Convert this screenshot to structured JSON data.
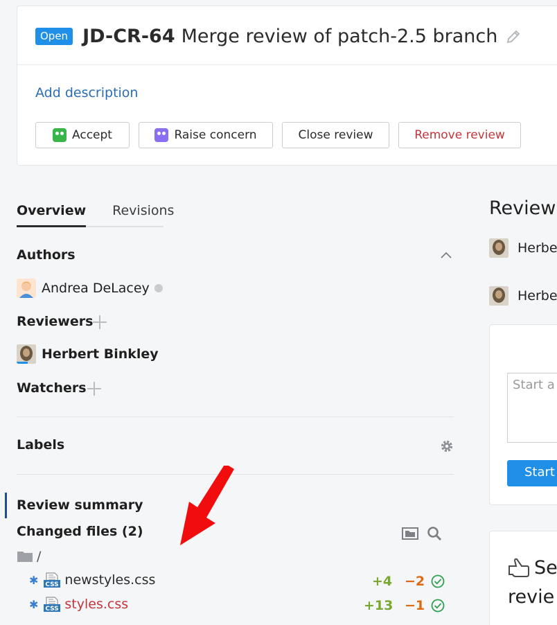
{
  "header": {
    "status": "Open",
    "review_id": "JD-CR-64",
    "title": "Merge review of patch-2.5 branch",
    "add_description": "Add description",
    "buttons": {
      "accept": "Accept",
      "raise_concern": "Raise concern",
      "close_review": "Close review",
      "remove_review": "Remove review"
    }
  },
  "tabs": [
    "Overview",
    "Revisions"
  ],
  "sidebar": {
    "authors_title": "Authors",
    "author_name": "Andrea DeLacey",
    "reviewers_title": "Reviewers",
    "reviewer_name": "Herbert Binkley",
    "watchers_title": "Watchers",
    "labels_title": "Labels",
    "review_summary": "Review summary",
    "changed_files_title": "Changed files (2)",
    "root_path": "/",
    "files": [
      {
        "name": "newstyles.css",
        "added": "+4",
        "removed": "−2"
      },
      {
        "name": "styles.css",
        "added": "+13",
        "removed": "−1"
      }
    ]
  },
  "right": {
    "heading": "Review",
    "person1": "Herber",
    "person2": "Herber",
    "comment_placeholder": "Start a",
    "start_button": "Start r",
    "send_line1": "Se",
    "send_line2": "revie"
  },
  "colors": {
    "accent": "#1f8fe8",
    "added": "#7aa632",
    "removed": "#e06a12",
    "danger": "#c2363a",
    "link": "#2a6db6"
  }
}
